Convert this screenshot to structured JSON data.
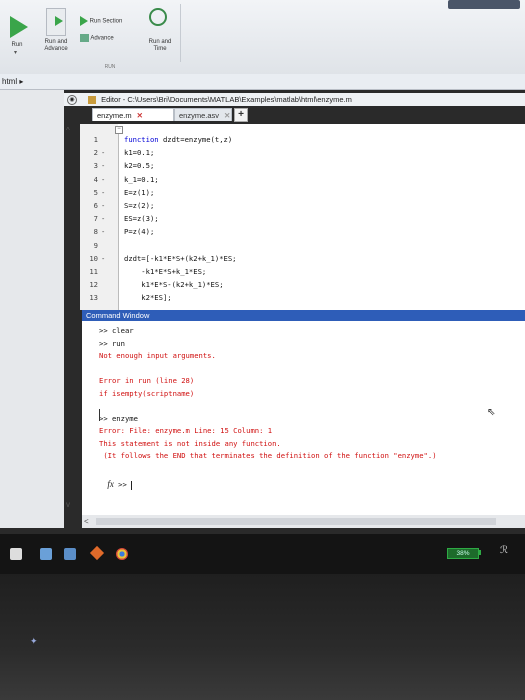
{
  "ribbon": {
    "run_label": "Run",
    "run_and_advance_label": "Run and Advance",
    "run_section_label": "Run Section",
    "advance_label": "Advance",
    "run_and_time_label": "Run and Time",
    "section_label": "RUN"
  },
  "path_bar": {
    "text": "html ▸"
  },
  "editor": {
    "title": "Editor - C:\\Users\\Bri\\Documents\\MATLAB\\Examples\\matlab\\html\\enzyme.m",
    "tabs": [
      {
        "label": "enzyme.m",
        "active": true
      },
      {
        "label": "enzyme.asv",
        "active": false
      }
    ],
    "add_tab_label": "+",
    "lines": [
      {
        "num": "1",
        "dash": "",
        "text": "function dzdt=enzyme(t,z)"
      },
      {
        "num": "2",
        "dash": "-",
        "text": "k1=0.1;"
      },
      {
        "num": "3",
        "dash": "-",
        "text": "k2=0.5;"
      },
      {
        "num": "4",
        "dash": "-",
        "text": "k_1=0.1;"
      },
      {
        "num": "5",
        "dash": "-",
        "text": "E=z(1);"
      },
      {
        "num": "6",
        "dash": "-",
        "text": "S=z(2);"
      },
      {
        "num": "7",
        "dash": "-",
        "text": "ES=z(3);"
      },
      {
        "num": "8",
        "dash": "-",
        "text": "P=z(4);"
      },
      {
        "num": "9",
        "dash": "",
        "text": ""
      },
      {
        "num": "10",
        "dash": "-",
        "text": "dzdt=[-k1*E*S+(k2+k_1)*ES;"
      },
      {
        "num": "11",
        "dash": "",
        "text": "    -k1*E*S+k_1*ES;"
      },
      {
        "num": "12",
        "dash": "",
        "text": "    k1*E*S-(k2+k_1)*ES;"
      },
      {
        "num": "13",
        "dash": "",
        "text": "    k2*ES];"
      }
    ]
  },
  "command_window": {
    "title": "Command Window",
    "lines": [
      {
        "text": ">> clear",
        "style": "normal"
      },
      {
        "text": ">> run",
        "style": "normal"
      },
      {
        "text": "Not enough input arguments.",
        "style": "err"
      },
      {
        "text": "",
        "style": "normal"
      },
      {
        "text": "Error in run (line 28)",
        "style": "err"
      },
      {
        "text": "if isempty(scriptname)",
        "style": "err"
      },
      {
        "text": "",
        "style": "normal"
      },
      {
        "text": ">> enzyme",
        "style": "normal"
      },
      {
        "text": "Error: File: enzyme.m Line: 15 Column: 1",
        "style": "err"
      },
      {
        "text": "This statement is not inside any function.",
        "style": "err"
      },
      {
        "text": " (It follows the END that terminates the definition of the function \"enzyme\".)",
        "style": "err"
      }
    ],
    "prompt_fx": "fx",
    "prompt": ">>"
  },
  "taskbar": {
    "battery": "38%"
  }
}
